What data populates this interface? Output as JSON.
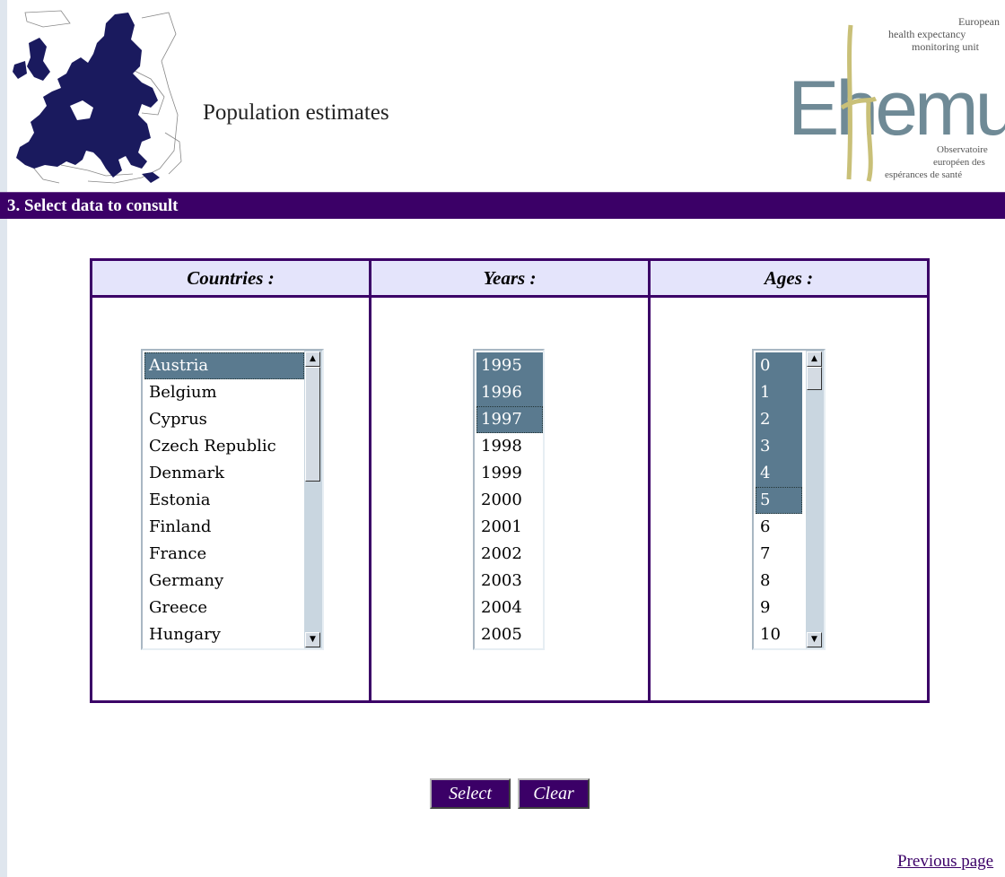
{
  "header": {
    "title": "Population estimates",
    "logo": {
      "word": "Ehemu",
      "top_line1": "European",
      "top_line2": "health expectancy",
      "top_line3": "monitoring unit",
      "bottom_line1": "Observatoire",
      "bottom_line2": "européen des",
      "bottom_line3": "espérances de santé"
    }
  },
  "section": {
    "title": "3. Select data to consult"
  },
  "columns": {
    "countries": {
      "label": "Countries :",
      "options": [
        "Austria",
        "Belgium",
        "Cyprus",
        "Czech Republic",
        "Denmark",
        "Estonia",
        "Finland",
        "France",
        "Germany",
        "Greece",
        "Hungary"
      ],
      "selected": [
        "Austria"
      ]
    },
    "years": {
      "label": "Years :",
      "options": [
        "1995",
        "1996",
        "1997",
        "1998",
        "1999",
        "2000",
        "2001",
        "2002",
        "2003",
        "2004",
        "2005"
      ],
      "selected": [
        "1995",
        "1996",
        "1997"
      ]
    },
    "ages": {
      "label": "Ages :",
      "options": [
        "0",
        "1",
        "2",
        "3",
        "4",
        "5",
        "6",
        "7",
        "8",
        "9",
        "10"
      ],
      "selected": [
        "0",
        "1",
        "2",
        "3",
        "4",
        "5"
      ]
    }
  },
  "buttons": {
    "select": "Select",
    "clear": "Clear"
  },
  "footer": {
    "previous_page": "Previous page"
  },
  "colors": {
    "accent": "#3b0067",
    "selection": "#5a7a8f",
    "header_fill": "#e4e4fb",
    "map_fill": "#1a1a5e"
  }
}
